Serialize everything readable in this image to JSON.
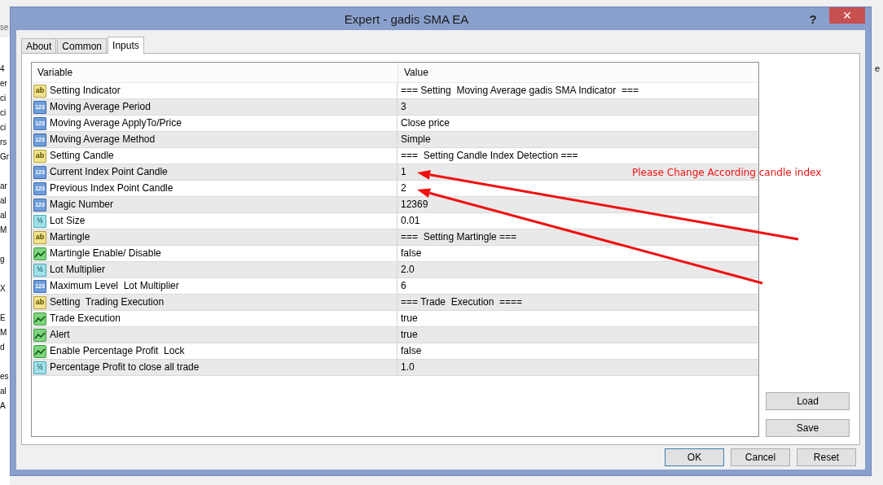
{
  "background": {
    "top_left": "se",
    "right": "e",
    "left_groups": [
      [
        "4",
        "er",
        "ci",
        "ci",
        "ci",
        "rs",
        "Gr"
      ],
      [
        "ar",
        "al",
        "al",
        "M"
      ],
      [
        "g"
      ],
      [
        "X"
      ],
      [
        "E",
        "M",
        "d"
      ],
      [
        "es",
        "al",
        "A"
      ]
    ]
  },
  "window": {
    "title": "Expert - gadis SMA EA",
    "help": "?",
    "close": "×"
  },
  "tabs": [
    {
      "label": "About",
      "selected": false
    },
    {
      "label": "Common",
      "selected": false
    },
    {
      "label": "Inputs",
      "selected": true
    }
  ],
  "table": {
    "columns": [
      "Variable",
      "Value"
    ],
    "rows": [
      {
        "kind": "text",
        "icon_text": "ab",
        "variable": "Setting Indicator",
        "value": "=== Setting  Moving Average gadis SMA Indicator  ==="
      },
      {
        "kind": "int",
        "icon_text": "123",
        "variable": "Moving Average Period",
        "value": "3"
      },
      {
        "kind": "int",
        "icon_text": "123",
        "variable": "Moving Average ApplyTo/Price",
        "value": "Close price"
      },
      {
        "kind": "int",
        "icon_text": "123",
        "variable": "Moving Average Method",
        "value": "Simple"
      },
      {
        "kind": "text",
        "icon_text": "ab",
        "variable": "Setting Candle",
        "value": "===  Setting Candle Index Detection ==="
      },
      {
        "kind": "int",
        "icon_text": "123",
        "variable": "Current Index Point Candle",
        "value": "1"
      },
      {
        "kind": "int",
        "icon_text": "123",
        "variable": "Previous Index Point Candle",
        "value": "2"
      },
      {
        "kind": "int",
        "icon_text": "123",
        "variable": "Magic Number",
        "value": "12369"
      },
      {
        "kind": "double",
        "icon_text": "½",
        "variable": "Lot Size",
        "value": "0.01"
      },
      {
        "kind": "text",
        "icon_text": "ab",
        "variable": "Martingle",
        "value": "===  Setting Martingle ==="
      },
      {
        "kind": "bool",
        "variable": "Martingle Enable/ Disable",
        "value": "false"
      },
      {
        "kind": "double",
        "icon_text": "½",
        "variable": "Lot Multiplier",
        "value": "2.0"
      },
      {
        "kind": "int",
        "icon_text": "123",
        "variable": "Maximum Level  Lot Multiplier",
        "value": "6"
      },
      {
        "kind": "text",
        "icon_text": "ab",
        "variable": "Setting  Trading Execution",
        "value": "=== Trade  Execution  ===="
      },
      {
        "kind": "bool",
        "variable": "Trade Execution",
        "value": "true"
      },
      {
        "kind": "bool",
        "variable": "Alert",
        "value": "true"
      },
      {
        "kind": "bool",
        "variable": "Enable Percentage Profit  Lock",
        "value": "false"
      },
      {
        "kind": "double",
        "icon_text": "½",
        "variable": "Percentage Profit to close all trade",
        "value": "1.0"
      }
    ]
  },
  "side_buttons": [
    "Load",
    "Save"
  ],
  "buttons": [
    "OK",
    "Cancel",
    "Reset"
  ],
  "annotation": {
    "text": "Please Change According candle index"
  }
}
